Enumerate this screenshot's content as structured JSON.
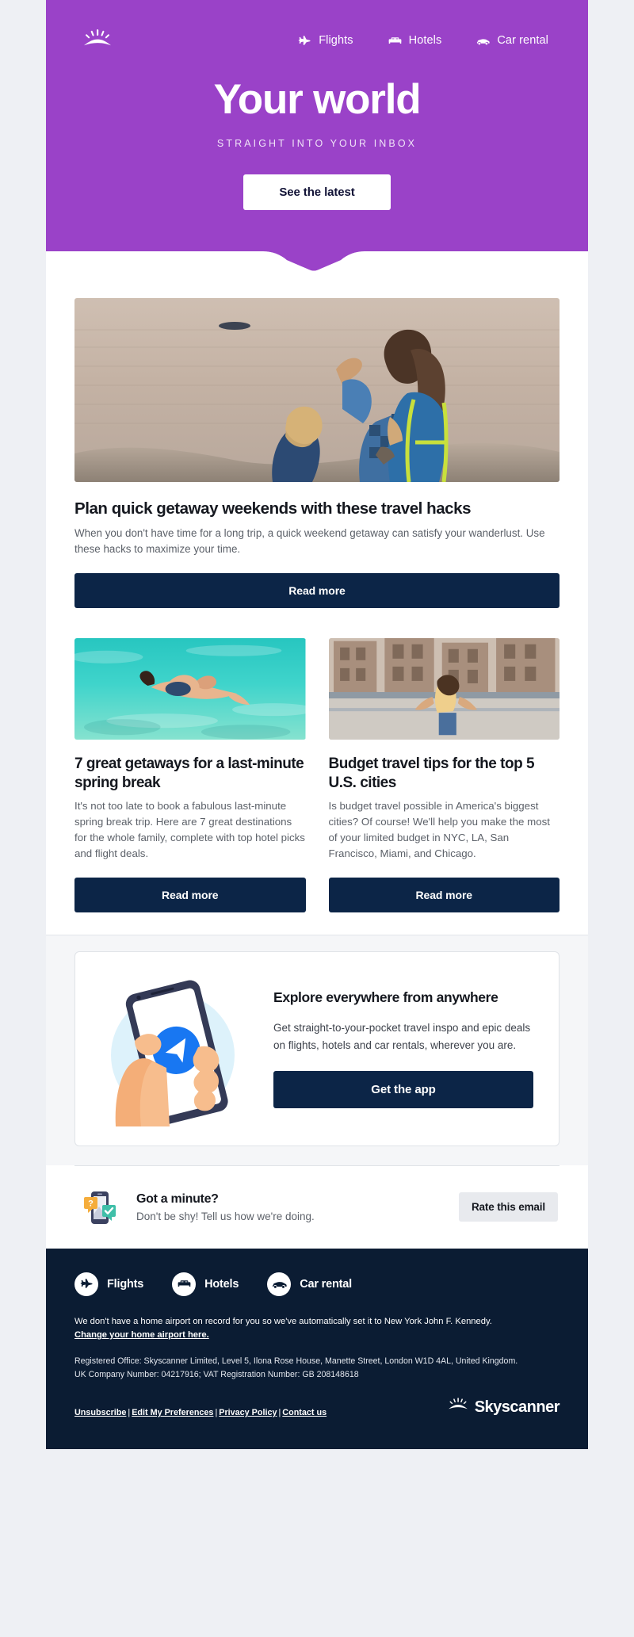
{
  "brand": {
    "name": "Skyscanner",
    "logo_icon": "sunburst-icon",
    "accent_purple": "#9a42c8",
    "dark_navy": "#0c2547",
    "footer_navy": "#0b1c33",
    "page_bg": "#eef0f4"
  },
  "hero": {
    "nav": [
      {
        "label": "Flights",
        "icon": "airplane-icon"
      },
      {
        "label": "Hotels",
        "icon": "bed-icon"
      },
      {
        "label": "Car rental",
        "icon": "car-icon"
      }
    ],
    "title": "Your world",
    "subtitle": "STRAIGHT INTO YOUR INBOX",
    "cta_label": "See the latest"
  },
  "articles": {
    "feature": {
      "image_alt": "Two women sitting on a cliff looking out over the sea at sunset, one pointing toward a boat",
      "title": "Plan quick getaway weekends with these travel hacks",
      "body": "When you don't have time for a long trip, a quick weekend getaway can satisfy your wanderlust. Use these hacks to maximize your time.",
      "cta_label": "Read more"
    },
    "cards": [
      {
        "image_alt": "Person snorkelling in clear turquoise shallow water",
        "title": "7 great getaways for a last-minute spring break",
        "body": "It's not too late to book a fabulous last-minute spring break trip. Here are 7 great destinations for the whole family, complete with top hotel picks and flight deals.",
        "cta_label": "Read more"
      },
      {
        "image_alt": "Woman with arms outstretched standing on a city street with brick buildings",
        "title": "Budget travel tips for the top 5 U.S. cities",
        "body": "Is budget travel possible in America's biggest cities? Of course! We'll help you make the most of your limited budget in NYC, LA, San Francisco, Miami, and Chicago.",
        "cta_label": "Read more"
      }
    ]
  },
  "app_promo": {
    "illustration_alt": "Hand holding a smartphone showing a blue paper-plane app icon",
    "title": "Explore everywhere from anywhere",
    "body": "Get straight-to-your-pocket travel inspo and epic deals on flights, hotels and car rentals, wherever you are.",
    "cta_label": "Get the app"
  },
  "feedback": {
    "illustration_alt": "Phone with a question speech bubble and a green checkmark",
    "title": "Got a minute?",
    "subtitle": "Don't be shy! Tell us how we're doing.",
    "cta_label": "Rate this email"
  },
  "footer": {
    "nav": [
      {
        "label": "Flights",
        "icon": "airplane-icon"
      },
      {
        "label": "Hotels",
        "icon": "bed-icon"
      },
      {
        "label": "Car rental",
        "icon": "car-icon"
      }
    ],
    "airport_note": "We don't have a home airport on record for you so we've automatically set it to New York John F. Kennedy.",
    "airport_link": "Change your home airport here.",
    "legal": "Registered Office: Skyscanner Limited, Level 5, Ilona Rose House, Manette Street, London W1D 4AL, United Kingdom. UK Company Number: 04217916; VAT Registration Number: GB 208148618",
    "links": [
      "Unsubscribe",
      "Edit My Preferences",
      "Privacy Policy",
      "Contact us"
    ],
    "link_separator": "|",
    "logo_text": "Skyscanner",
    "logo_icon": "sunburst-icon"
  }
}
